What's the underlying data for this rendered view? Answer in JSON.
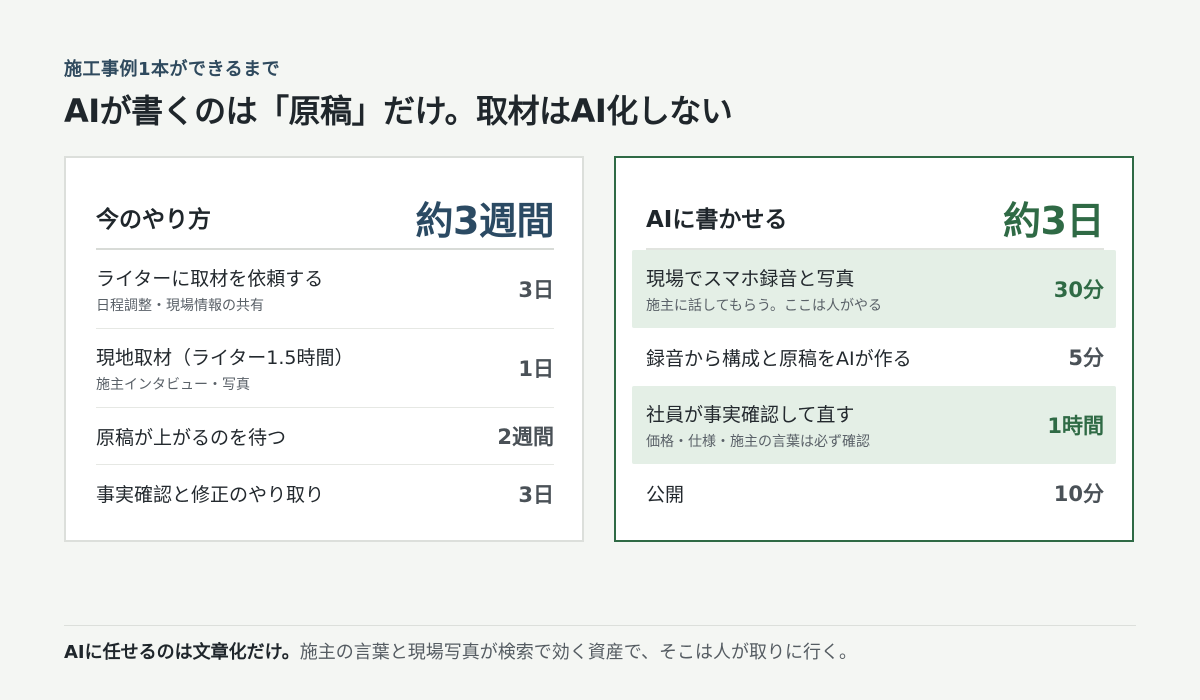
{
  "eyebrow": "施工事例1本ができるまで",
  "headline": "AIが書くのは「原稿」だけ。取材はAI化しない",
  "left_card": {
    "title": "今のやり方",
    "total": "約3週間",
    "rows": [
      {
        "label": "ライターに取材を依頼する",
        "sub": "日程調整・現場情報の共有",
        "value": "3日"
      },
      {
        "label": "現地取材（ライター1.5時間）",
        "sub": "施主インタビュー・写真",
        "value": "1日"
      },
      {
        "label": "原稿が上がるのを待つ",
        "sub": "",
        "value": "2週間"
      },
      {
        "label": "事実確認と修正のやり取り",
        "sub": "",
        "value": "3日"
      }
    ]
  },
  "right_card": {
    "title": "AIに書かせる",
    "total": "約3日",
    "accent_color": "#2f6a45",
    "highlight_color": "#e4efe6",
    "rows": [
      {
        "label": "現場でスマホ録音と写真",
        "sub": "施主に話してもらう。ここは人がやる",
        "value": "30分",
        "highlight": true
      },
      {
        "label": "録音から構成と原稿をAIが作る",
        "sub": "",
        "value": "5分",
        "highlight": false
      },
      {
        "label": "社員が事実確認して直す",
        "sub": "価格・仕様・施主の言葉は必ず確認",
        "value": "1時間",
        "highlight": true
      },
      {
        "label": "公開",
        "sub": "",
        "value": "10分",
        "highlight": false
      }
    ]
  },
  "footer": {
    "strong": "AIに任せるのは文章化だけ。",
    "rest": "施主の言葉と現場写真が検索で効く資産で、そこは人が取りに行く。"
  }
}
